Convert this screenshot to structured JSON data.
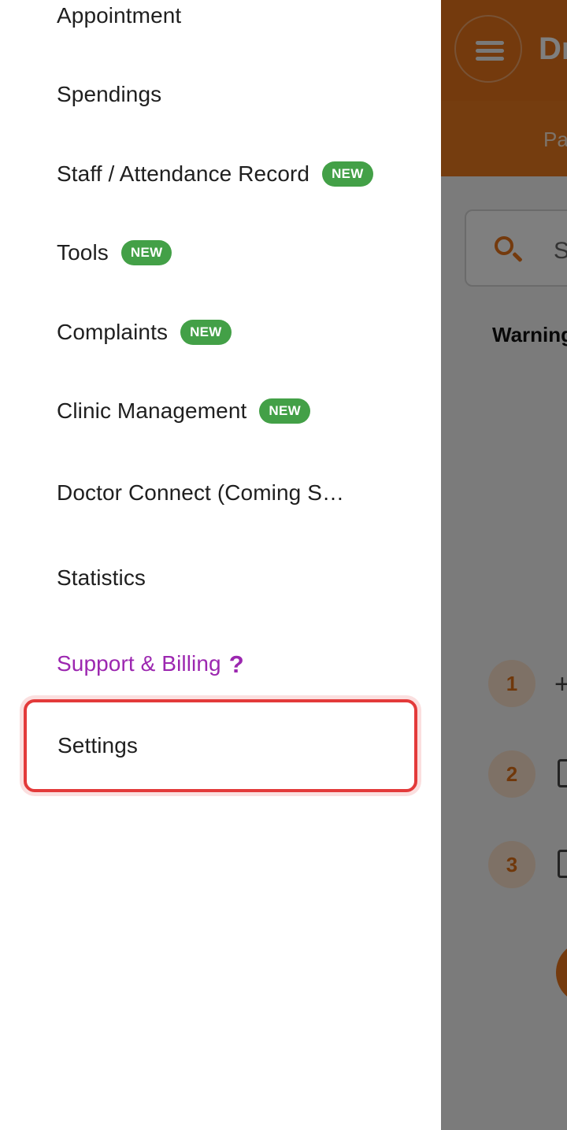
{
  "background": {
    "title": "Dr",
    "tab_label": "Pa",
    "search_placeholder": "S",
    "warning_label": "Warning",
    "steps": [
      "1",
      "2",
      "3"
    ],
    "accent_color": "#e8741b"
  },
  "drawer": {
    "items": [
      {
        "label": "Appointment"
      },
      {
        "label": "Spendings"
      },
      {
        "label": "Staff / Attendance Record",
        "badge": "NEW"
      },
      {
        "label": "Tools",
        "badge": "NEW"
      },
      {
        "label": "Complaints",
        "badge": "NEW"
      },
      {
        "label": "Clinic Management",
        "badge": "NEW"
      },
      {
        "label": "Doctor Connect (Coming Soon)"
      },
      {
        "label": "Statistics"
      },
      {
        "label": "Support & Billing",
        "icon": "help-icon",
        "help_glyph": "?",
        "color": "#9c27b0"
      },
      {
        "label": "Settings",
        "highlighted": true,
        "highlight_color": "#e33a3a"
      }
    ],
    "badge_color": "#43a047"
  }
}
